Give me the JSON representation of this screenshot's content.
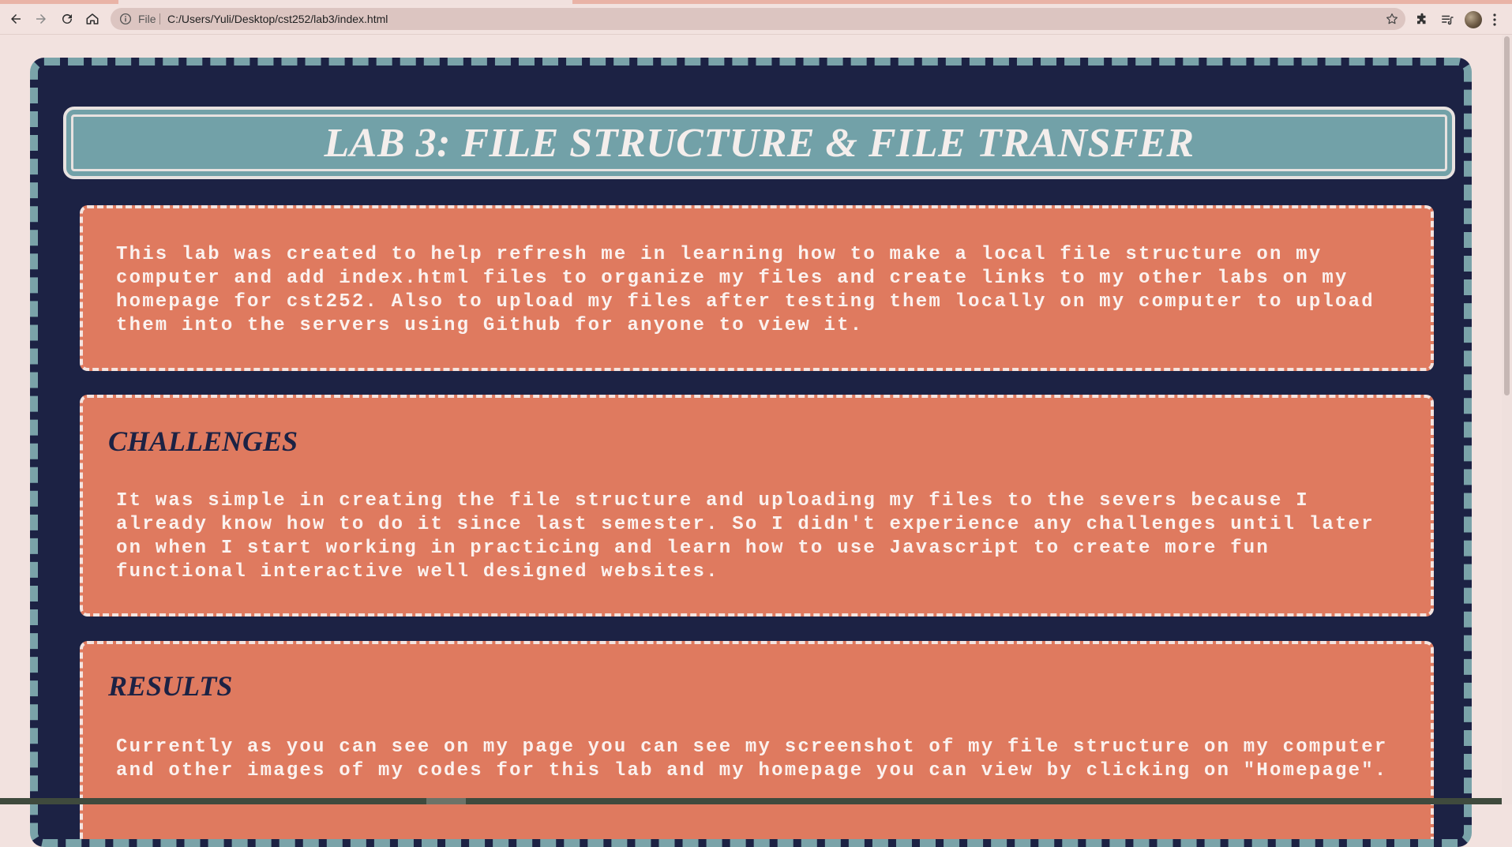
{
  "browser": {
    "scheme_label": "File",
    "url": "C:/Users/Yuli/Desktop/cst252/lab3/index.html",
    "icons": [
      "back-icon",
      "forward-icon",
      "reload-icon",
      "home-icon",
      "info-icon",
      "star-icon",
      "extensions-icon",
      "reading-list-icon",
      "profile-avatar",
      "menu-icon"
    ]
  },
  "page": {
    "title": "LAB 3: FILE STRUCTURE & FILE TRANSFER",
    "intro": "This lab was created to help refresh me in learning how to make a local file structure on my computer and add index.html files to organize my files and create links to my other labs on my homepage for cst252. Also to upload my files after testing them locally on my computer to upload them into the servers using Github for anyone to view it.",
    "challenges": {
      "heading": "CHALLENGES",
      "text": "It was simple in creating the file structure and uploading my files to the severs because I already know how to do it since last semester. So I didn't experience any challenges until later on when I start working in practicing and learn how to use Javascript to create more fun functional interactive well designed websites."
    },
    "results": {
      "heading": "RESULTS",
      "text": "Currently as you can see on my page you can see my screenshot of my file structure on my computer and other images of my codes for this lab and my homepage you can view by clicking on \"Homepage\"."
    }
  },
  "colors": {
    "page_bg": "#f2e2df",
    "card_bg": "#1c2244",
    "card_border": "#7aa3a9",
    "banner_bg": "#72a1a8",
    "section_bg": "#df7a5f",
    "section_text": "#fbf2ef",
    "heading_text": "#1c2244"
  }
}
